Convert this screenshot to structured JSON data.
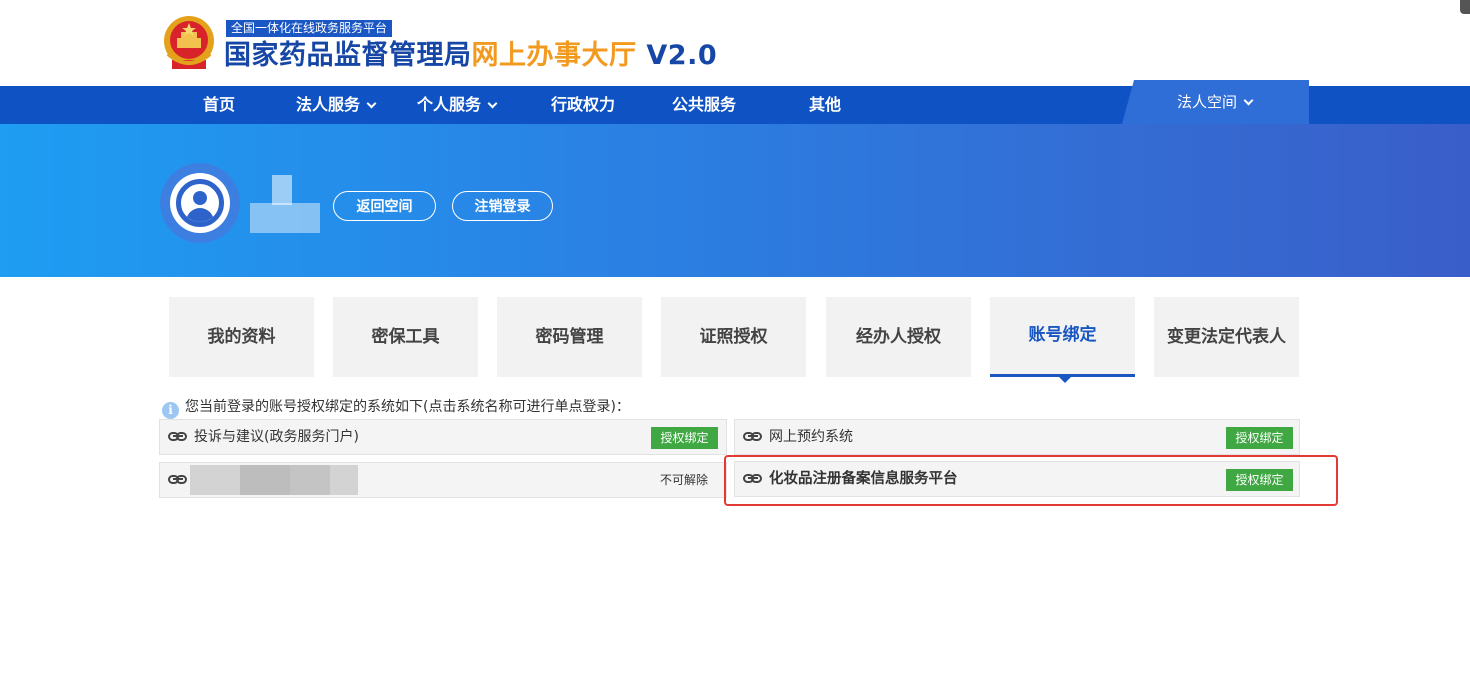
{
  "header": {
    "platform_tag": "全国一体化在线政务服务平台",
    "title_part1": "国家药品监督管理局",
    "title_part2": "网上办事大厅",
    "title_part3": " V2.0"
  },
  "nav": {
    "items": [
      {
        "label": "首页"
      },
      {
        "label": "法人服务"
      },
      {
        "label": "个人服务"
      },
      {
        "label": "行政权力"
      },
      {
        "label": "公共服务"
      },
      {
        "label": "其他"
      }
    ],
    "legal_space": "法人空间"
  },
  "banner": {
    "back_button": "返回空间",
    "logout_button": "注销登录"
  },
  "tabs": [
    {
      "label": "我的资料"
    },
    {
      "label": "密保工具"
    },
    {
      "label": "密码管理"
    },
    {
      "label": "证照授权"
    },
    {
      "label": "经办人授权"
    },
    {
      "label": "账号绑定",
      "active": true
    },
    {
      "label": "变更法定代表人"
    }
  ],
  "info": {
    "icon": "i",
    "text": "您当前登录的账号授权绑定的系统如下(点击系统名称可进行单点登录)："
  },
  "systems": [
    {
      "name": "投诉与建议(政务服务门户)",
      "action": "授权绑定"
    },
    {
      "name": "网上预约系统",
      "action": "授权绑定"
    },
    {
      "name": "",
      "status": "不可解除"
    },
    {
      "name": "化妆品注册备案信息服务平台",
      "action": "授权绑定"
    }
  ],
  "colors": {
    "nav": "#0f52c4",
    "accent": "#1856c2",
    "bind_button": "#3fa843",
    "highlight": "#e53935"
  }
}
